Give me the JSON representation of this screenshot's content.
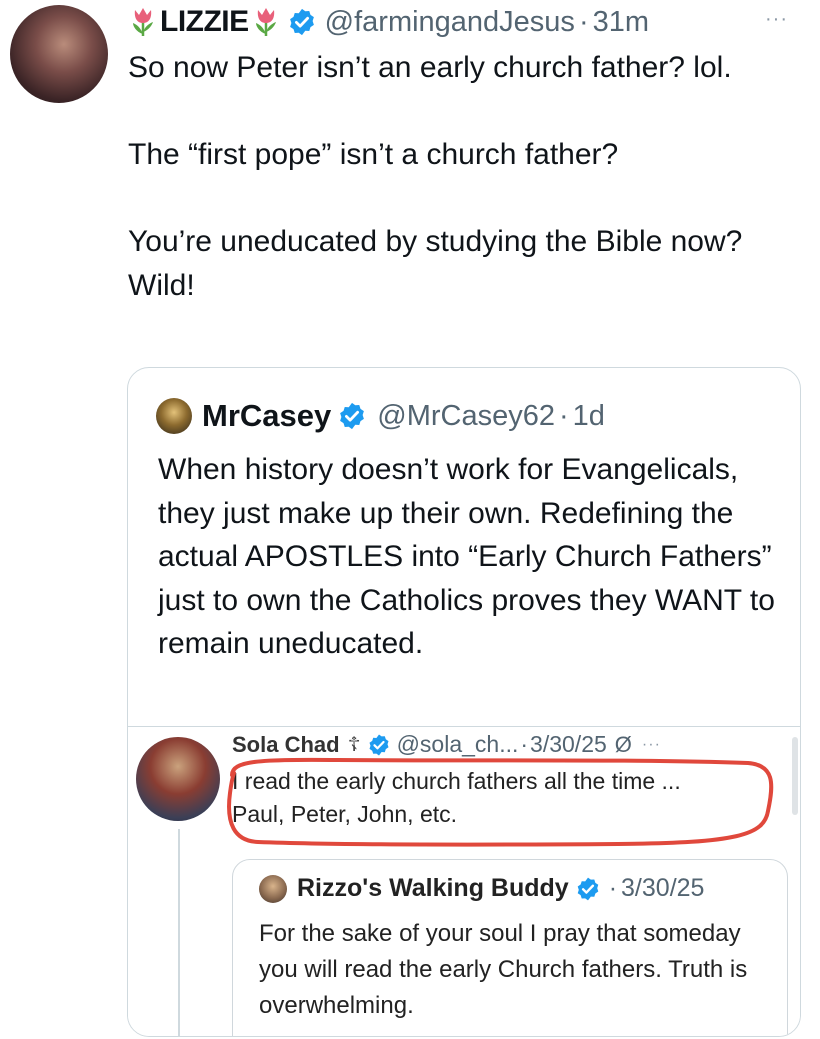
{
  "tweet": {
    "author_name": "LIZZIE",
    "handle": "@farmingandJesus",
    "separator": "·",
    "time": "31m",
    "more_label": "···",
    "text": "So now Peter isn’t an early church father? lol.\n\nThe “first pope” isn’t a church father?\n\nYou’re uneducated by studying the Bible now? Wild!"
  },
  "quote": {
    "author_name": "MrCasey",
    "handle": "@MrCasey62",
    "separator": "·",
    "time": "1d",
    "text": "When history doesn’t work for Evangelicals, they just make up their own. Redefining the actual APOSTLES into “Early Church Fathers” just to own the Catholics proves they WANT to remain uneducated."
  },
  "embedded": {
    "author_name": "Sola Chad",
    "cross": "☦",
    "handle": "@sola_ch...",
    "separator": "·",
    "date": "3/30/25",
    "edit_icon": "Ø",
    "more_label": "···",
    "text": "I read the early church fathers all the time ...\nPaul, Peter, John, etc.",
    "highlight_color": "#e0483c",
    "quoted": {
      "author_name": "Rizzo's Walking Buddy",
      "separator": "·",
      "date": "3/30/25",
      "text": "For the sake of your soul I pray that someday you will read the early Church fathers. Truth is overwhelming."
    }
  },
  "colors": {
    "verified": "#1d9bf0",
    "secondary_text": "#536471",
    "tulip_petal": "#e8607a",
    "tulip_leaf": "#5aa844"
  }
}
